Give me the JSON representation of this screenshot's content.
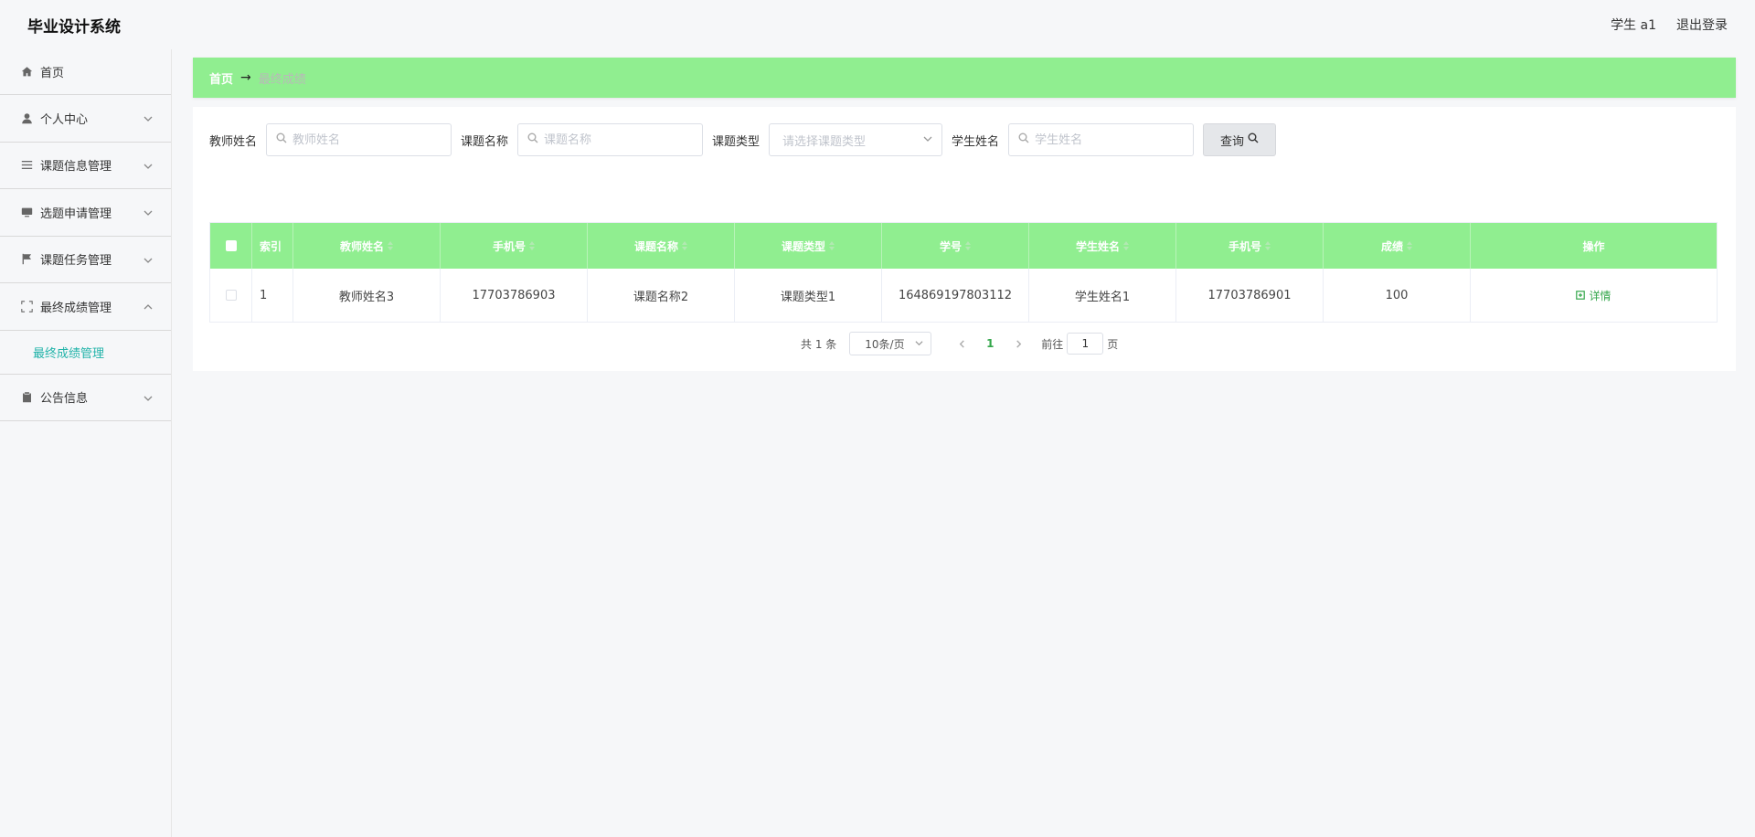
{
  "header": {
    "title": "毕业设计系统",
    "user": "学生 a1",
    "logout": "退出登录"
  },
  "sidebar": {
    "items": [
      {
        "label": "首页",
        "icon": "home-icon"
      },
      {
        "label": "个人中心",
        "icon": "user-icon"
      },
      {
        "label": "课题信息管理",
        "icon": "list-icon"
      },
      {
        "label": "选题申请管理",
        "icon": "monitor-icon"
      },
      {
        "label": "课题任务管理",
        "icon": "flag-icon"
      },
      {
        "label": "最终成绩管理",
        "icon": "fullscreen-icon"
      },
      {
        "label": "公告信息",
        "icon": "clipboard-icon"
      }
    ],
    "submenu": "最终成绩管理"
  },
  "breadcrumb": {
    "home": "首页",
    "arrow": "→",
    "current": "最终成绩"
  },
  "filters": {
    "teacher_label": "教师姓名",
    "teacher_placeholder": "教师姓名",
    "topic_label": "课题名称",
    "topic_placeholder": "课题名称",
    "type_label": "课题类型",
    "type_placeholder": "请选择课题类型",
    "student_label": "学生姓名",
    "student_placeholder": "学生姓名",
    "query": "查询"
  },
  "table": {
    "headers": [
      "索引",
      "教师姓名",
      "手机号",
      "课题名称",
      "课题类型",
      "学号",
      "学生姓名",
      "手机号",
      "成绩",
      "操作"
    ],
    "rows": [
      {
        "index": "1",
        "teacher": "教师姓名3",
        "teacher_phone": "17703786903",
        "topic": "课题名称2",
        "type": "课题类型1",
        "student_id": "164869197803112",
        "student": "学生姓名1",
        "student_phone": "17703786901",
        "score": "100",
        "action": "详情"
      }
    ]
  },
  "pagination": {
    "total": "共 1 条",
    "page_size": "10条/页",
    "current": "1",
    "goto": "前往",
    "jump_value": "1",
    "page_unit": "页"
  },
  "colors": {
    "accent_green": "#90ee90",
    "teal": "#21b3a9",
    "link_green": "#33a64a"
  }
}
